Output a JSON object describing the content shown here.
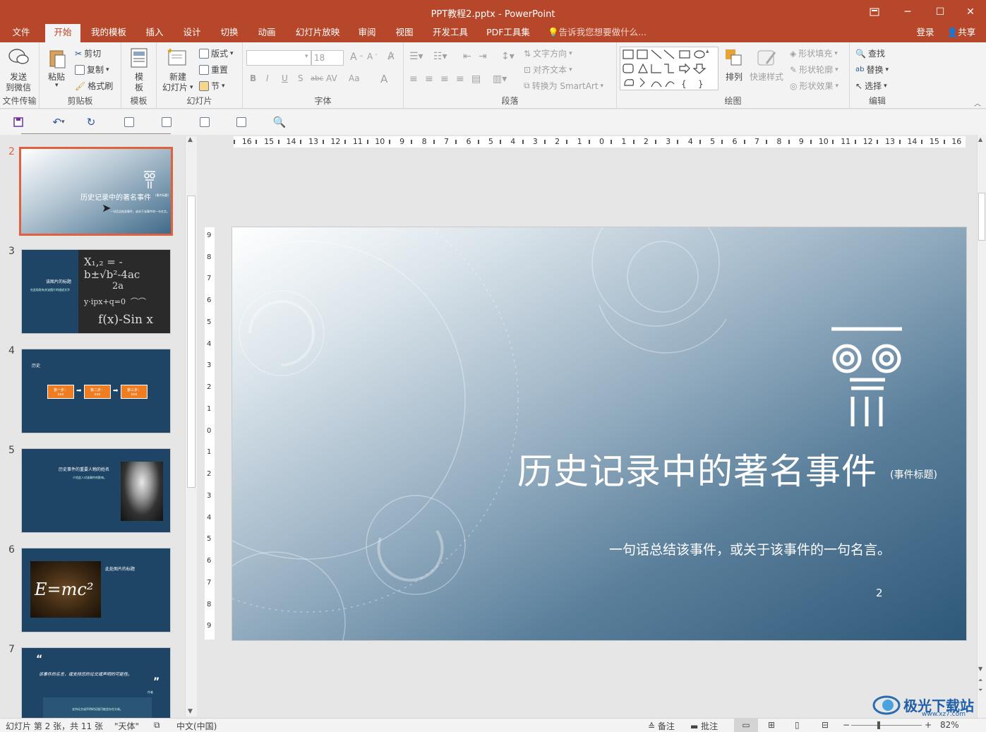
{
  "window": {
    "title": "PPT教程2.pptx - PowerPoint",
    "restore_icon": "ribbon-display-icon",
    "minimize": "─",
    "maximize": "☐",
    "close": "✕"
  },
  "tabs": [
    "文件",
    "开始",
    "我的模板",
    "插入",
    "设计",
    "切换",
    "动画",
    "幻灯片放映",
    "审阅",
    "视图",
    "开发工具",
    "PDF工具集"
  ],
  "active_tab": "开始",
  "tell_me": "告诉我您想要做什么...",
  "login": "登录",
  "share": "共享",
  "ribbon": {
    "wechat": {
      "label1": "发送",
      "label2": "到微信",
      "group": "文件传输"
    },
    "clipboard": {
      "paste": "粘贴",
      "cut": "剪切",
      "copy": "复制",
      "format_painter": "格式刷",
      "group": "剪贴板"
    },
    "template": {
      "label1": "模",
      "label2": "板",
      "group": "模板"
    },
    "slides": {
      "new1": "新建",
      "new2": "幻灯片",
      "layout": "版式",
      "reset": "重置",
      "section": "节",
      "group": "幻灯片"
    },
    "font": {
      "name": "",
      "size": "18",
      "bold": "B",
      "italic": "I",
      "underline": "U",
      "shadow": "S",
      "strike": "abc",
      "spacing": "AV",
      "case": "Aa",
      "color": "A",
      "group": "字体"
    },
    "paragraph": {
      "text_direction": "文字方向",
      "align_text": "对齐文本",
      "smartart": "转换为 SmartArt",
      "group": "段落"
    },
    "drawing": {
      "arrange": "排列",
      "quick_styles": "快速样式",
      "fill": "形状填充",
      "outline": "形状轮廓",
      "effects": "形状效果",
      "group": "绘图"
    },
    "editing": {
      "find": "查找",
      "replace": "替换",
      "select": "选择",
      "group": "编辑"
    }
  },
  "ruler_h": [
    "16",
    "15",
    "14",
    "13",
    "12",
    "11",
    "10",
    "9",
    "8",
    "7",
    "6",
    "5",
    "4",
    "3",
    "2",
    "1",
    "0",
    "1",
    "2",
    "3",
    "4",
    "5",
    "6",
    "7",
    "8",
    "9",
    "10",
    "11",
    "12",
    "13",
    "14",
    "15",
    "16"
  ],
  "ruler_v": [
    "9",
    "8",
    "7",
    "6",
    "5",
    "4",
    "3",
    "2",
    "1",
    "0",
    "1",
    "2",
    "3",
    "4",
    "5",
    "6",
    "7",
    "8",
    "9"
  ],
  "thumbnails": [
    {
      "num": "2",
      "title": "历史记录中的著名事件",
      "sub": "(事件标题)",
      "caption": "一句话总结该事件，或关于该事件的一句名言。"
    },
    {
      "num": "3",
      "title": "该图片的标题",
      "body": "在此粘贴有关该图片的描述文字"
    },
    {
      "num": "4",
      "label": "历史",
      "steps": [
        "第一步：",
        "第二步：",
        "第三步："
      ],
      "step_text": "xxx"
    },
    {
      "num": "5",
      "title": "历史事件的重要人物的姓名",
      "body": "介绍此人对该事件的影响。"
    },
    {
      "num": "6",
      "title": "此处图片的标题",
      "formula": "E=mc²"
    },
    {
      "num": "7",
      "quote": "该事件的名言，或支持您的论文或声明的可能性。",
      "author": "作者",
      "body": "支持论文或声明的证据可能会存在分歧。"
    }
  ],
  "slide": {
    "title": "历史记录中的著名事件",
    "title_note": "(事件标题)",
    "subtitle": "一句话总结该事件，或关于该事件的一句名言。",
    "page": "2"
  },
  "status": {
    "slide_info": "幻灯片 第 2 张，共 11 张",
    "theme": "\"天体\"",
    "language": "中文(中国)",
    "notes": "备注",
    "comments": "批注",
    "zoom": "82%"
  },
  "watermark": {
    "name": "极光下载站",
    "url": "www.xz7.com"
  }
}
